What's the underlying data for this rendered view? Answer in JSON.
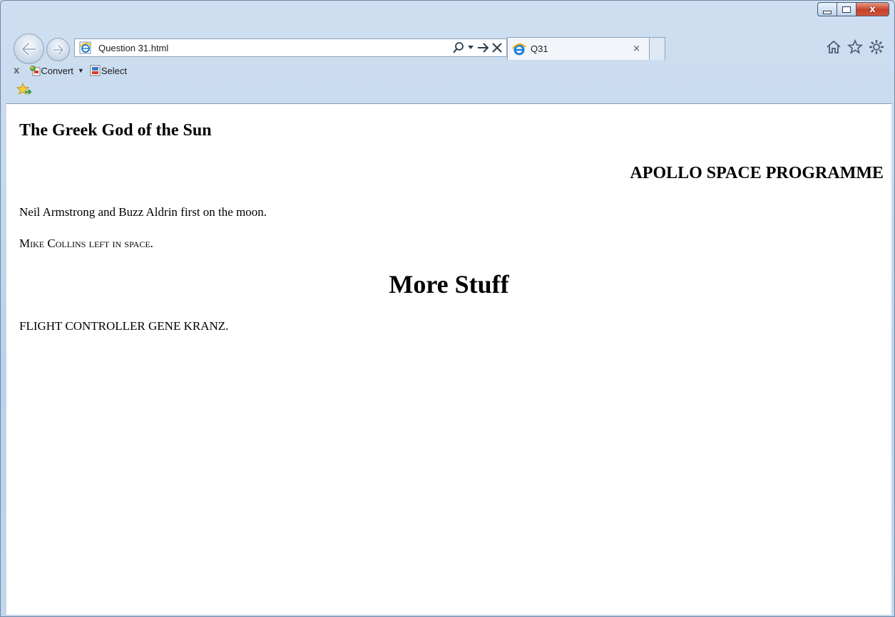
{
  "window": {
    "address": "Question 31.html",
    "tab_title": "Q31",
    "tab_close": "×",
    "controls": {
      "minimize": "–",
      "maximize": "□",
      "close": "x"
    }
  },
  "toolbar": {
    "close_x": "x",
    "convert_label": "Convert",
    "select_label": "Select"
  },
  "icons": {
    "back": "back-arrow-icon",
    "forward": "forward-arrow-icon",
    "search": "search-icon",
    "go": "go-arrow-icon",
    "stop": "stop-icon",
    "home": "home-icon",
    "favorites": "star-icon",
    "tools": "gear-icon"
  },
  "page": {
    "heading_sun": "The Greek God of the Sun",
    "heading_apollo": "APOLLO SPACE PROGRAMME",
    "paragraph_armstrong": "Neil Armstrong and Buzz Aldrin first on the moon.",
    "paragraph_collins": "Mike Collins left in space.",
    "heading_more": "More Stuff",
    "paragraph_kranz": "FLIGHT CONTROLLER GENE KRANZ."
  }
}
